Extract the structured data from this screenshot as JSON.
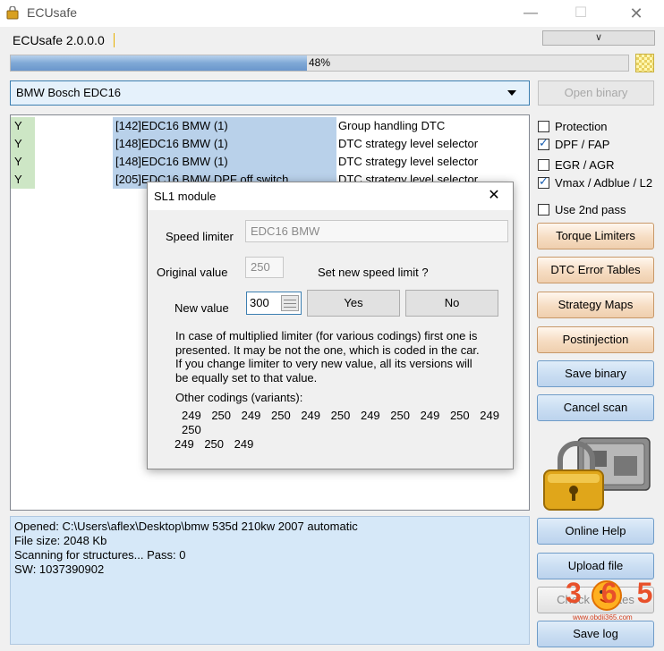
{
  "window": {
    "title": "ECUsafe",
    "minimize_glyph": "—",
    "maximize_glyph": "☐",
    "close_glyph": "✕"
  },
  "header": {
    "version": "ECUsafe 2.0.0.0",
    "dropdown_glyph": "∨",
    "progress_label": "48%",
    "progress_fraction": 0.48
  },
  "ecu_select": {
    "value": "BMW Bosch EDC16",
    "open_binary_label": "Open binary"
  },
  "dtc_list": [
    {
      "flag": "Y",
      "code": "[142]EDC16 BMW (1)",
      "desc": "Group handling DTC"
    },
    {
      "flag": "Y",
      "code": "[148]EDC16 BMW (1)",
      "desc": "DTC strategy level selector"
    },
    {
      "flag": "Y",
      "code": "[148]EDC16 BMW (1)",
      "desc": "DTC strategy level selector"
    },
    {
      "flag": "Y",
      "code": "[205]EDC16 BMW DPF off switch",
      "desc": "DTC strategy level selector"
    }
  ],
  "options": [
    {
      "label": "Protection",
      "checked": false
    },
    {
      "label": "DPF / FAP",
      "checked": true
    },
    {
      "label": "EGR / AGR",
      "checked": false
    },
    {
      "label": "Vmax / Adblue / L2",
      "checked": true
    },
    {
      "label": "Use 2nd pass",
      "checked": false
    }
  ],
  "buttons": {
    "torque_limiters": "Torque Limiters",
    "dtc_error_tables": "DTC Error Tables",
    "strategy_maps": "Strategy Maps",
    "postinjection": "Postinjection",
    "save_binary": "Save binary",
    "cancel_scan": "Cancel scan",
    "online_help": "Online Help",
    "upload_file": "Upload file",
    "check_updates": "Check updates",
    "save_log": "Save log"
  },
  "log": {
    "opened": "Opened:   C:\\Users\\aflex\\Desktop\\bmw 535d 210kw 2007 automatic",
    "file_size": "File size: 2048 Kb",
    "scanning": "Scanning for structures... Pass: 0",
    "sw": "SW: 1037390902"
  },
  "watermark": {
    "number": "365",
    "url": "www.obdii365.com"
  },
  "dialog": {
    "title": "SL1 module",
    "close_glyph": "✕",
    "speed_limiter_label": "Speed limiter",
    "speed_limiter_value": "EDC16 BMW",
    "original_value_label": "Original value",
    "original_value": "250",
    "prompt": "Set new speed limit ?",
    "new_value_label": "New value",
    "new_value": "300",
    "yes_label": "Yes",
    "no_label": "No",
    "info_lines": [
      "In case of multiplied limiter (for various codings) first one is",
      "presented. It may be not the one, which is coded in the car.",
      "If you change limiter to very new value, all its versions will",
      "be equally set to that value."
    ],
    "other_codings_label": "Other codings (variants):",
    "variants": [
      "249",
      "250",
      "249",
      "250",
      "249",
      "250",
      "249",
      "250",
      "249",
      "250",
      "249",
      "250",
      "249",
      "250",
      "249"
    ]
  }
}
